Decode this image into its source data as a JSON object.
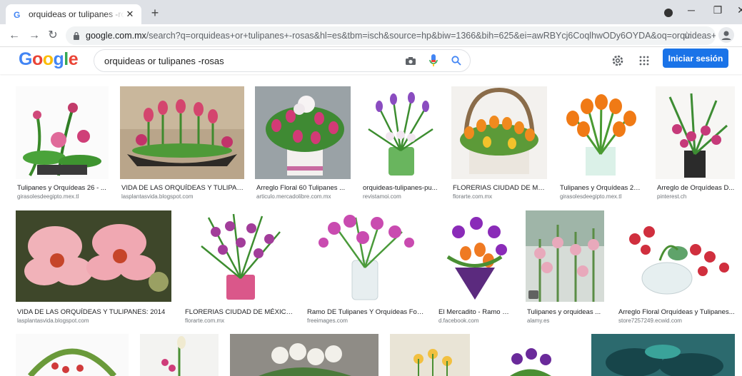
{
  "browser": {
    "tab_title": "orquideas or tulipanes -rosas - B",
    "tab_close": "✕",
    "new_tab": "+",
    "url_host": "google.com.mx",
    "url_rest": "/search?q=orquideas+or+tulipanes+-rosas&hl=es&tbm=isch&source=hp&biw=1366&bih=625&ei=awRBYcj6CoqlhwODy6OYDA&oq=orquideas+or+tulipanes+-..."
  },
  "google": {
    "logo": [
      "G",
      "o",
      "o",
      "g",
      "l",
      "e"
    ],
    "query": "orquideas or tulipanes -rosas",
    "signin_label": "Iniciar sesión"
  },
  "colors": {
    "accent": "#1a73e8",
    "logo_blue": "#4285f4",
    "logo_red": "#ea4335",
    "logo_yellow": "#fbbc05",
    "logo_green": "#34a853"
  },
  "results": [
    [
      {
        "title": "Tulipanes y Orquídeas 26 - ...",
        "source": "girasolesdeegipto.mex.tl"
      },
      {
        "title": "VIDA DE LAS ORQUÍDEAS Y TULIPAN...",
        "source": "lasplantasvida.blogspot.com"
      },
      {
        "title": "Arreglo Floral 60 Tulipanes ...",
        "source": "articulo.mercadolibre.com.mx"
      },
      {
        "title": "orquideas-tulipanes-pu...",
        "source": "revistamoi.com"
      },
      {
        "title": "FLORERIAS CIUDAD DE MÉX...",
        "source": "florarte.com.mx"
      },
      {
        "title": "Tulipanes y Orquídeas 20...",
        "source": "girasolesdeegipto.mex.tl"
      },
      {
        "title": "Arreglo de Orquídeas D...",
        "source": "pinterest.ch"
      }
    ],
    [
      {
        "title": "VIDA DE LAS ORQUÍDEAS Y TULIPANES: 2014",
        "source": "lasplantasvida.blogspot.com"
      },
      {
        "title": "FLORERIAS CIUDAD DE MÉXICO ...",
        "source": "florarte.com.mx"
      },
      {
        "title": "Ramo DE Tulipanes Y Orquídeas Fot...",
        "source": "freeimages.com"
      },
      {
        "title": "El Mercadito - Ramo de...",
        "source": "d.facebook.com"
      },
      {
        "title": "Tulipanes y orquideas ...",
        "source": "alamy.es"
      },
      {
        "title": "Arreglo Floral Orquídeas y Tulipanes...",
        "source": "store7257249.ecwid.com"
      }
    ]
  ]
}
